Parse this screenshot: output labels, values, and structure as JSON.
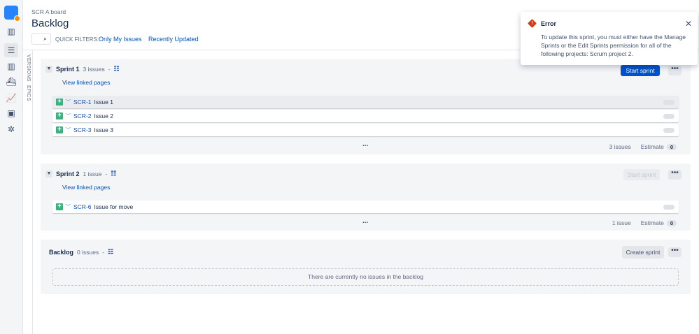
{
  "header": {
    "breadcrumb": "SCR A board",
    "title": "Backlog",
    "quick_filters_label": "QUICK FILTERS:",
    "filters": [
      "Only My Issues",
      "Recently Updated"
    ]
  },
  "side_tabs": [
    "VERSIONS",
    "EPICS"
  ],
  "sprints": [
    {
      "name": "Sprint 1",
      "count": "3 issues",
      "dash": "-",
      "linked": "View linked pages",
      "button": "Start sprint",
      "issues": [
        {
          "key": "SCR-1",
          "summary": "Issue 1"
        },
        {
          "key": "SCR-2",
          "summary": "Issue 2"
        },
        {
          "key": "SCR-3",
          "summary": "Issue 3"
        }
      ],
      "footer_count": "3 issues",
      "estimate_label": "Estimate",
      "estimate": "0"
    },
    {
      "name": "Sprint 2",
      "count": "1 issue",
      "dash": "-",
      "linked": "View linked pages",
      "button": "Start sprint",
      "issues": [
        {
          "key": "SCR-6",
          "summary": "Issue for move"
        }
      ],
      "footer_count": "1 issue",
      "estimate_label": "Estimate",
      "estimate": "0"
    }
  ],
  "backlog": {
    "name": "Backlog",
    "count": "0 issues",
    "dash": "-",
    "button": "Create sprint",
    "empty": "There are currently no issues in the backlog"
  },
  "error": {
    "title": "Error",
    "message": "To update this sprint, you must either have the Manage Sprints or the Edit Sprints permission for all of the following projects: Scrum project 2."
  },
  "more": "•••",
  "ellipsis": "..."
}
